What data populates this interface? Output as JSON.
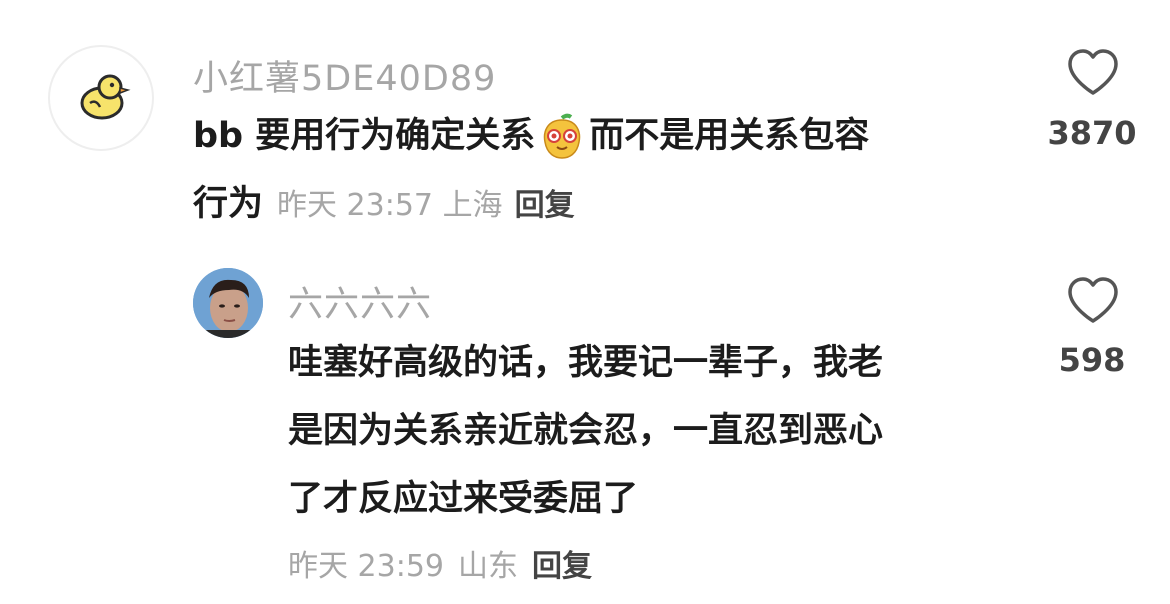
{
  "comments": [
    {
      "username": "小红薯5DE40D89",
      "text_line1_a": "bb 要用行为确定关系",
      "text_line1_b": "而不是用关系包容",
      "text_line2": "行为",
      "time": "昨天 23:57",
      "location": "上海",
      "reply_label": "回复",
      "like_count": "3870",
      "emoji_name": "pear-face-emoji",
      "avatar_icon": "chick-icon"
    },
    {
      "username": "六六六六",
      "text_lines": [
        "哇塞好高级的话，我要记一辈子，我老",
        "是因为关系亲近就会忍，一直忍到恶心",
        "了才反应过来受委屈了"
      ],
      "time": "昨天 23:59",
      "location": "山东",
      "reply_label": "回复",
      "like_count": "598",
      "avatar_icon": "person-photo"
    }
  ],
  "colors": {
    "username": "#a6a6a6",
    "text": "#1c1c1c",
    "meta": "#a6a6a6",
    "reply": "#444444",
    "icon_stroke": "#555555"
  }
}
